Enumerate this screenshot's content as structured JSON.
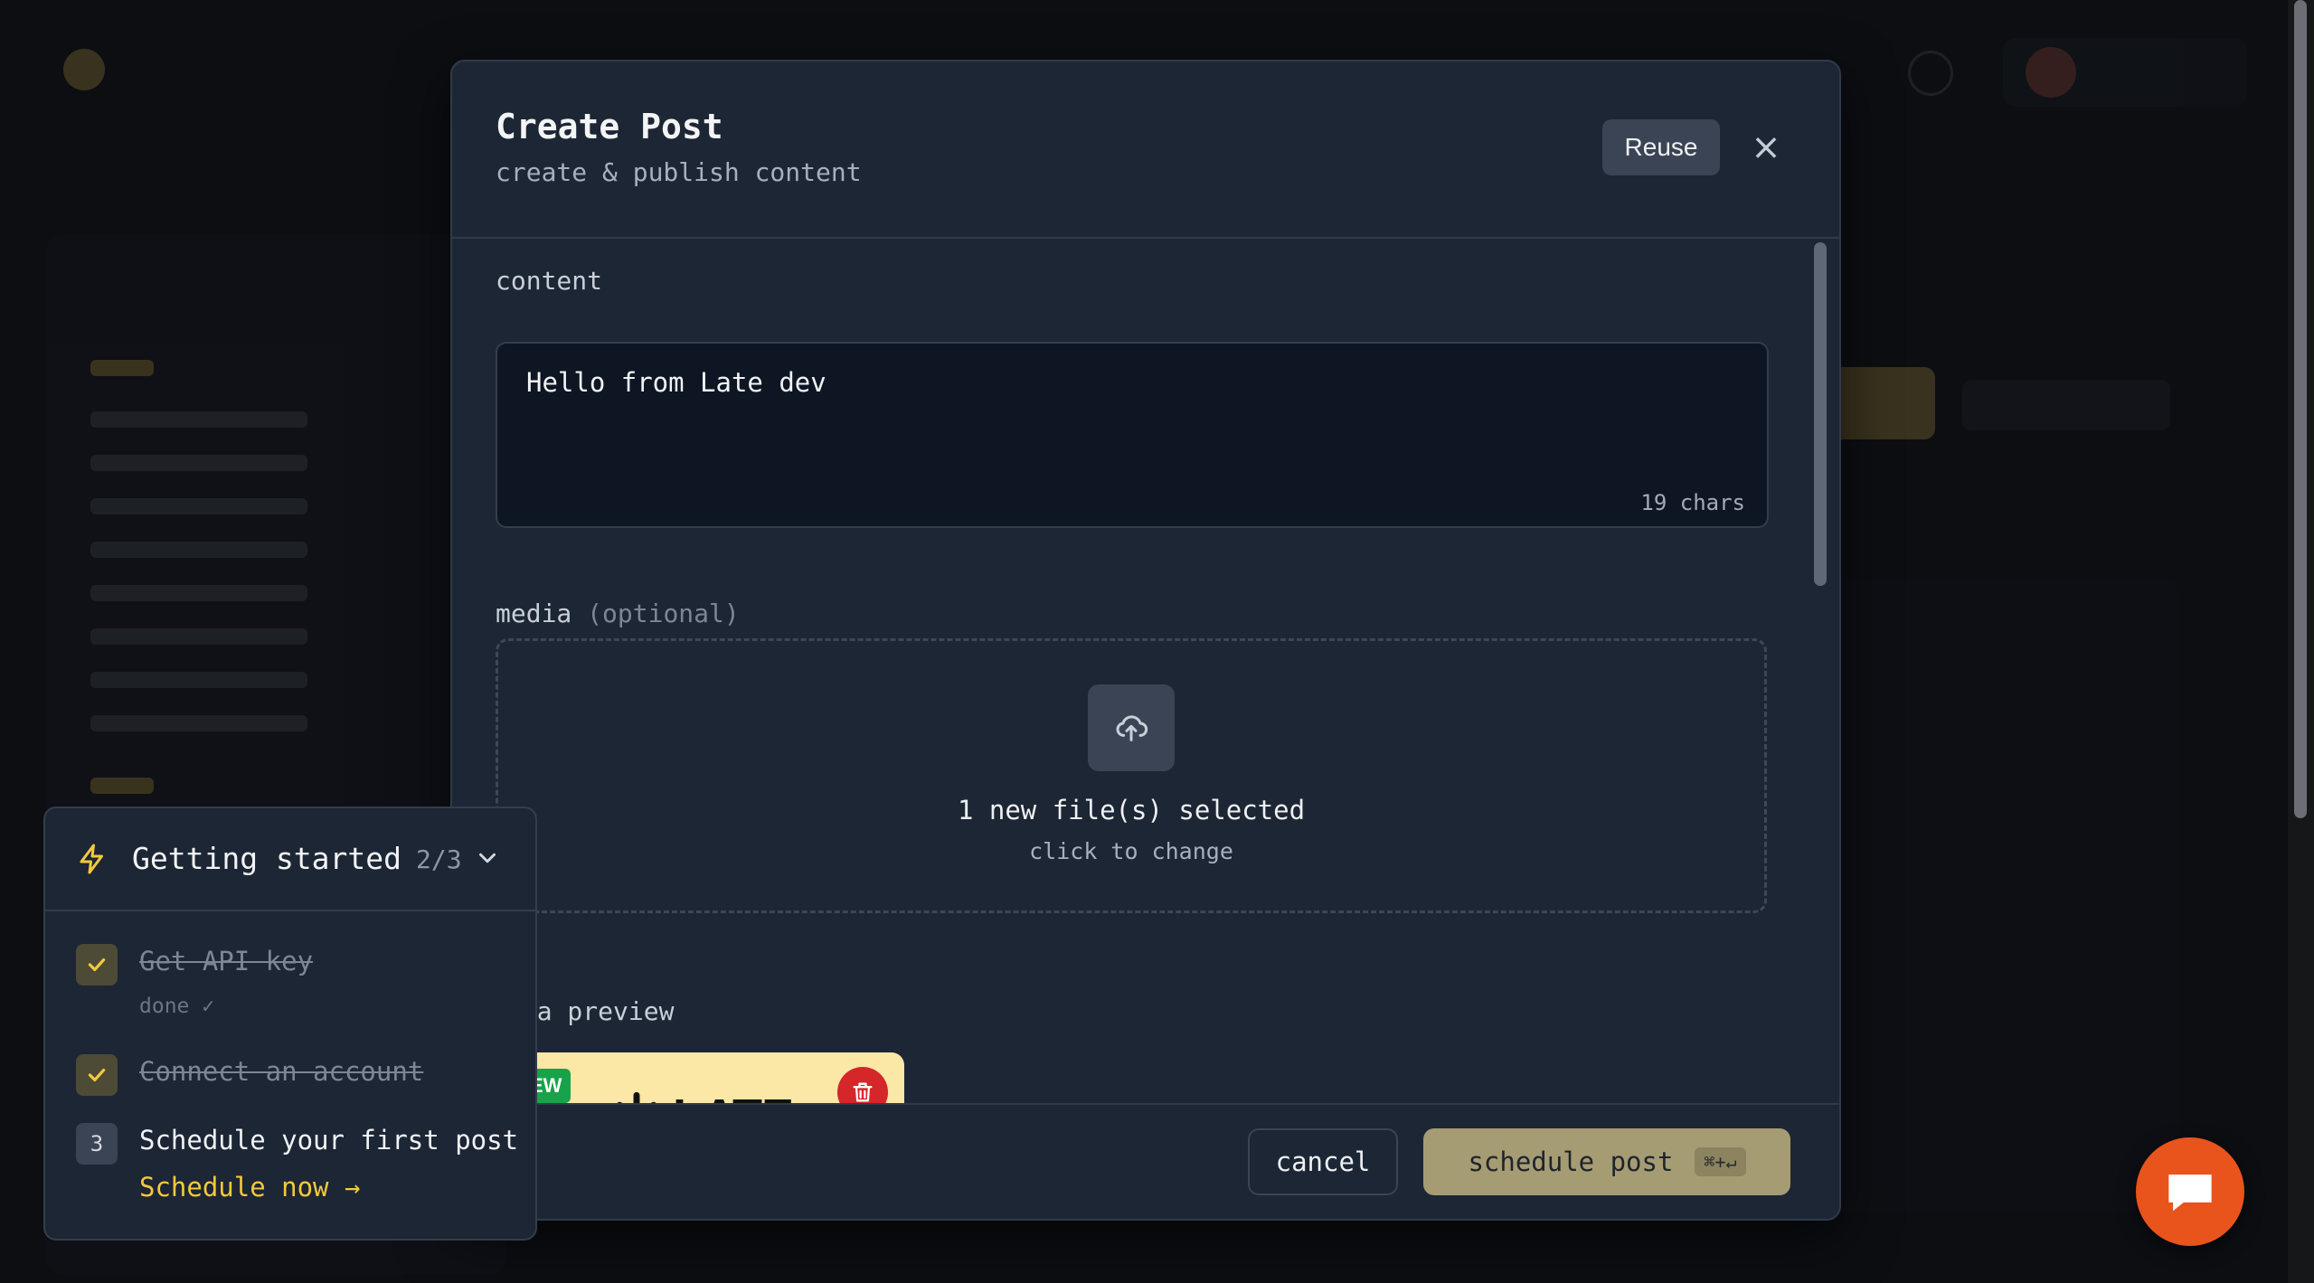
{
  "modal": {
    "title": "Create Post",
    "subtitle": "create & publish content",
    "reuse_label": "Reuse",
    "close_icon": "×"
  },
  "content": {
    "label": "content",
    "value": "Hello from Late dev",
    "char_count": "19 chars"
  },
  "media": {
    "label": "media",
    "optional_label": "(optional)",
    "selected_text": "1 new file(s) selected",
    "change_hint": "click to change",
    "icon": "upload-cloud-icon"
  },
  "media_preview": {
    "label": "dia preview",
    "badge": "EW",
    "brand_text": "LATE",
    "delete_icon": "trash-icon"
  },
  "footer": {
    "cancel_label": "cancel",
    "schedule_label": "schedule post",
    "shortcut": "⌘+↵"
  },
  "getting_started": {
    "title": "Getting started",
    "progress": "2/3",
    "items": [
      {
        "label": "Get API key",
        "done": true,
        "note": "done ✓"
      },
      {
        "label": "Connect an account",
        "done": true
      },
      {
        "label": "Schedule your first post",
        "done": false,
        "step": "3",
        "action": "Schedule now →"
      }
    ]
  },
  "colors": {
    "modal_bg": "#1d2634",
    "accent_yellow": "#f3c93c",
    "schedule_button": "#a59c74",
    "chat_bubble": "#e8541c",
    "delete_red": "#d5262a",
    "badge_green": "#16a34a"
  },
  "chat": {
    "icon": "chat-bubble-icon"
  }
}
